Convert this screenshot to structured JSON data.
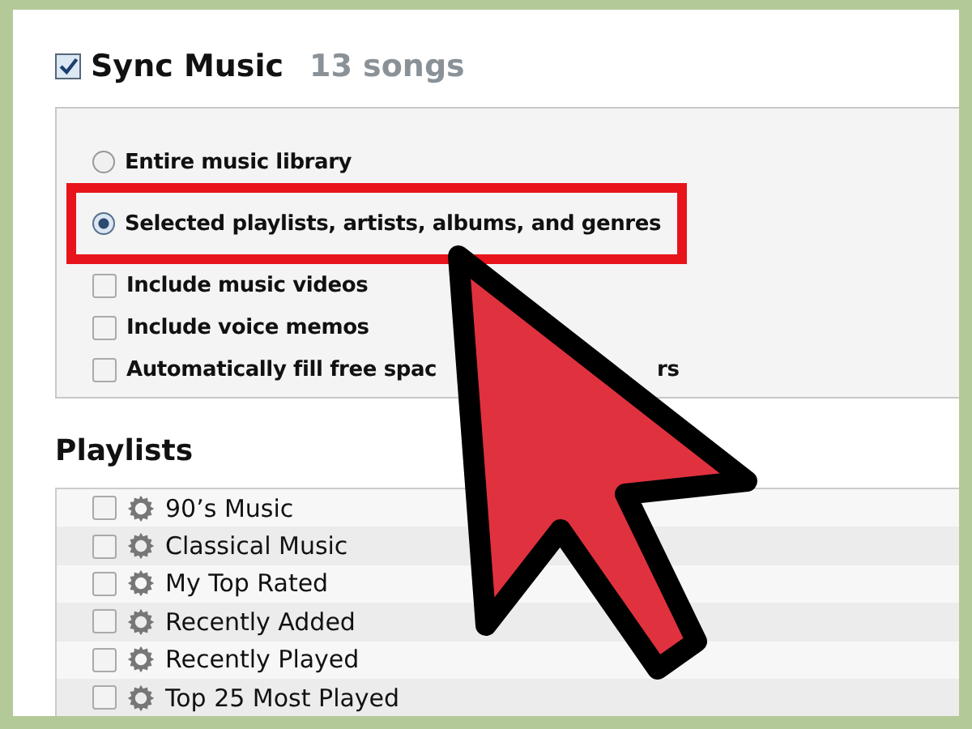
{
  "sync": {
    "label": "Sync Music",
    "checked": true,
    "count": "13 songs"
  },
  "options": [
    {
      "kind": "radio",
      "label": "Entire music library",
      "selected": false,
      "highlighted": false
    },
    {
      "kind": "radio",
      "label": "Selected playlists, artists, albums, and genres",
      "selected": true,
      "highlighted": true
    },
    {
      "kind": "checkbox",
      "label": "Include music videos",
      "checked": false
    },
    {
      "kind": "checkbox",
      "label": "Include voice memos",
      "checked": false
    },
    {
      "kind": "checkbox",
      "label": "Automatically fill free spac",
      "checked": false,
      "tail": "rs"
    }
  ],
  "playlists": {
    "title": "Playlists",
    "items": [
      {
        "label": "90’s Music",
        "checked": false
      },
      {
        "label": "Classical Music",
        "checked": false
      },
      {
        "label": "My Top Rated",
        "checked": false
      },
      {
        "label": "Recently Added",
        "checked": false
      },
      {
        "label": "Recently Played",
        "checked": false
      },
      {
        "label": "Top 25 Most Played",
        "checked": false
      }
    ]
  }
}
